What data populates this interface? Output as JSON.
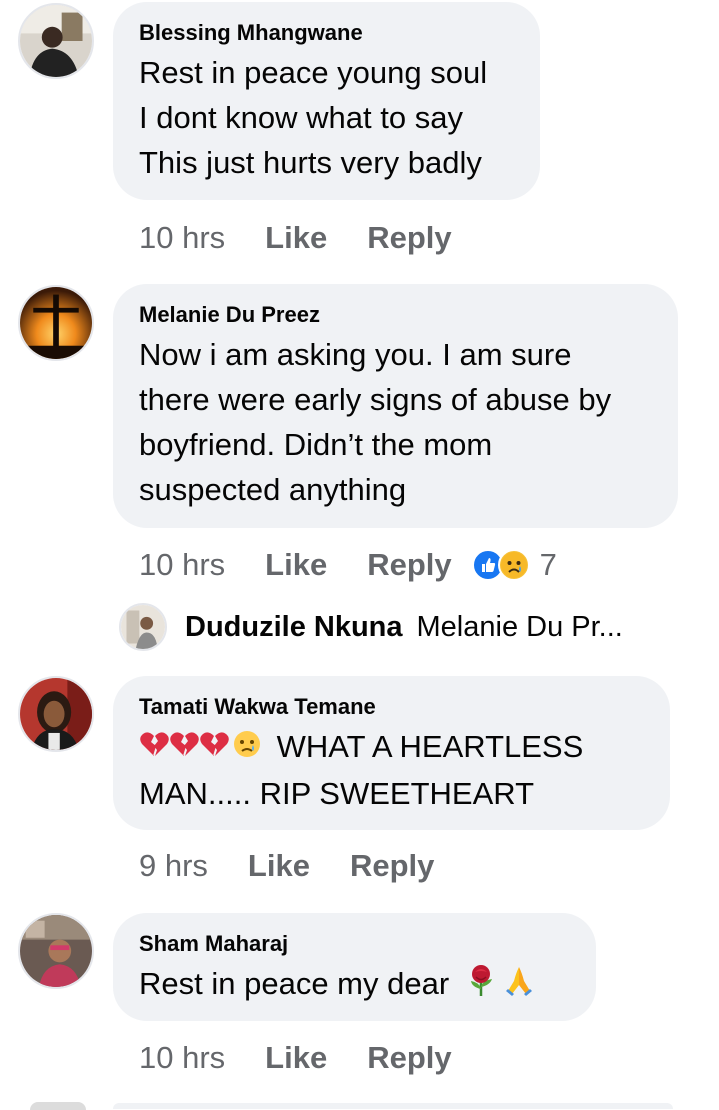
{
  "comments": [
    {
      "author": "Blessing Mhangwane",
      "text": "Rest in peace young soul\nI dont know what to say\nThis just hurts very badly",
      "time": "10 hrs",
      "like": "Like",
      "reply": "Reply"
    },
    {
      "author": "Melanie Du Preez",
      "text": "Now i am asking you. I am sure\nthere were early signs of abuse by\nboyfriend. Didn’t the mom\nsuspected anything",
      "time": "10 hrs",
      "like": "Like",
      "reply": "Reply",
      "reaction_count": "7",
      "reactions": [
        "like-reaction-icon",
        "sad-reaction-icon"
      ],
      "reply_preview": {
        "author": "Duduzile Nkuna",
        "text": "Melanie Du Pr..."
      }
    },
    {
      "author": "Tamati Wakwa Temane",
      "text_suffix": "WHAT A HEARTLESS",
      "text_line2": "MAN..... RIP SWEETHEART",
      "emoji": [
        "broken-heart-icon",
        "broken-heart-icon",
        "broken-heart-icon",
        "crying-face-icon"
      ],
      "time": "9 hrs",
      "like": "Like",
      "reply": "Reply"
    },
    {
      "author": "Sham Maharaj",
      "text": "Rest in peace my dear",
      "emoji": [
        "rose-icon",
        "folded-hands-icon"
      ],
      "time": "10 hrs",
      "like": "Like",
      "reply": "Reply"
    }
  ],
  "colors": {
    "bubble": "#f0f2f5",
    "secondary_text": "#65676b",
    "primary_text": "#050505",
    "like_blue": "#1877f2"
  }
}
